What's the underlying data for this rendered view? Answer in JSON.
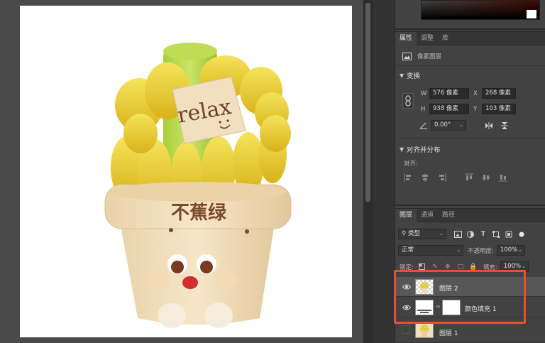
{
  "document": {
    "pot_text": "不蕉绿",
    "sign_text": "relax"
  },
  "properties_panel": {
    "tabs": [
      "属性",
      "调整",
      "库"
    ],
    "layer_kind": "像素图层",
    "transform": {
      "title": "变换",
      "w_label": "W",
      "w_value": "576 像素",
      "x_label": "X",
      "x_value": "268 像素",
      "h_label": "H",
      "h_value": "938 像素",
      "y_label": "Y",
      "y_value": "103 像素",
      "angle_value": "0.00°"
    },
    "align": {
      "title": "对齐并分布",
      "subtitle": "对齐:"
    }
  },
  "layers_panel": {
    "tabs": [
      "图层",
      "通道",
      "路径"
    ],
    "filter_kind": "类型",
    "blend_mode": "正常",
    "opacity_label": "不透明度:",
    "opacity_value": "100%",
    "lock_label": "锁定:",
    "fill_label": "填充:",
    "fill_value": "100%",
    "layers": [
      {
        "name": "图层 2",
        "selected": true,
        "visible": true
      },
      {
        "name": "颜色填充 1",
        "selected": false,
        "visible": true
      },
      {
        "name": "图层 1",
        "selected": false,
        "visible": false
      }
    ]
  },
  "colors": {
    "accent_highlight": "#e5532d",
    "panel_bg": "#424242",
    "canvas_bg": "#4a4a4a"
  }
}
